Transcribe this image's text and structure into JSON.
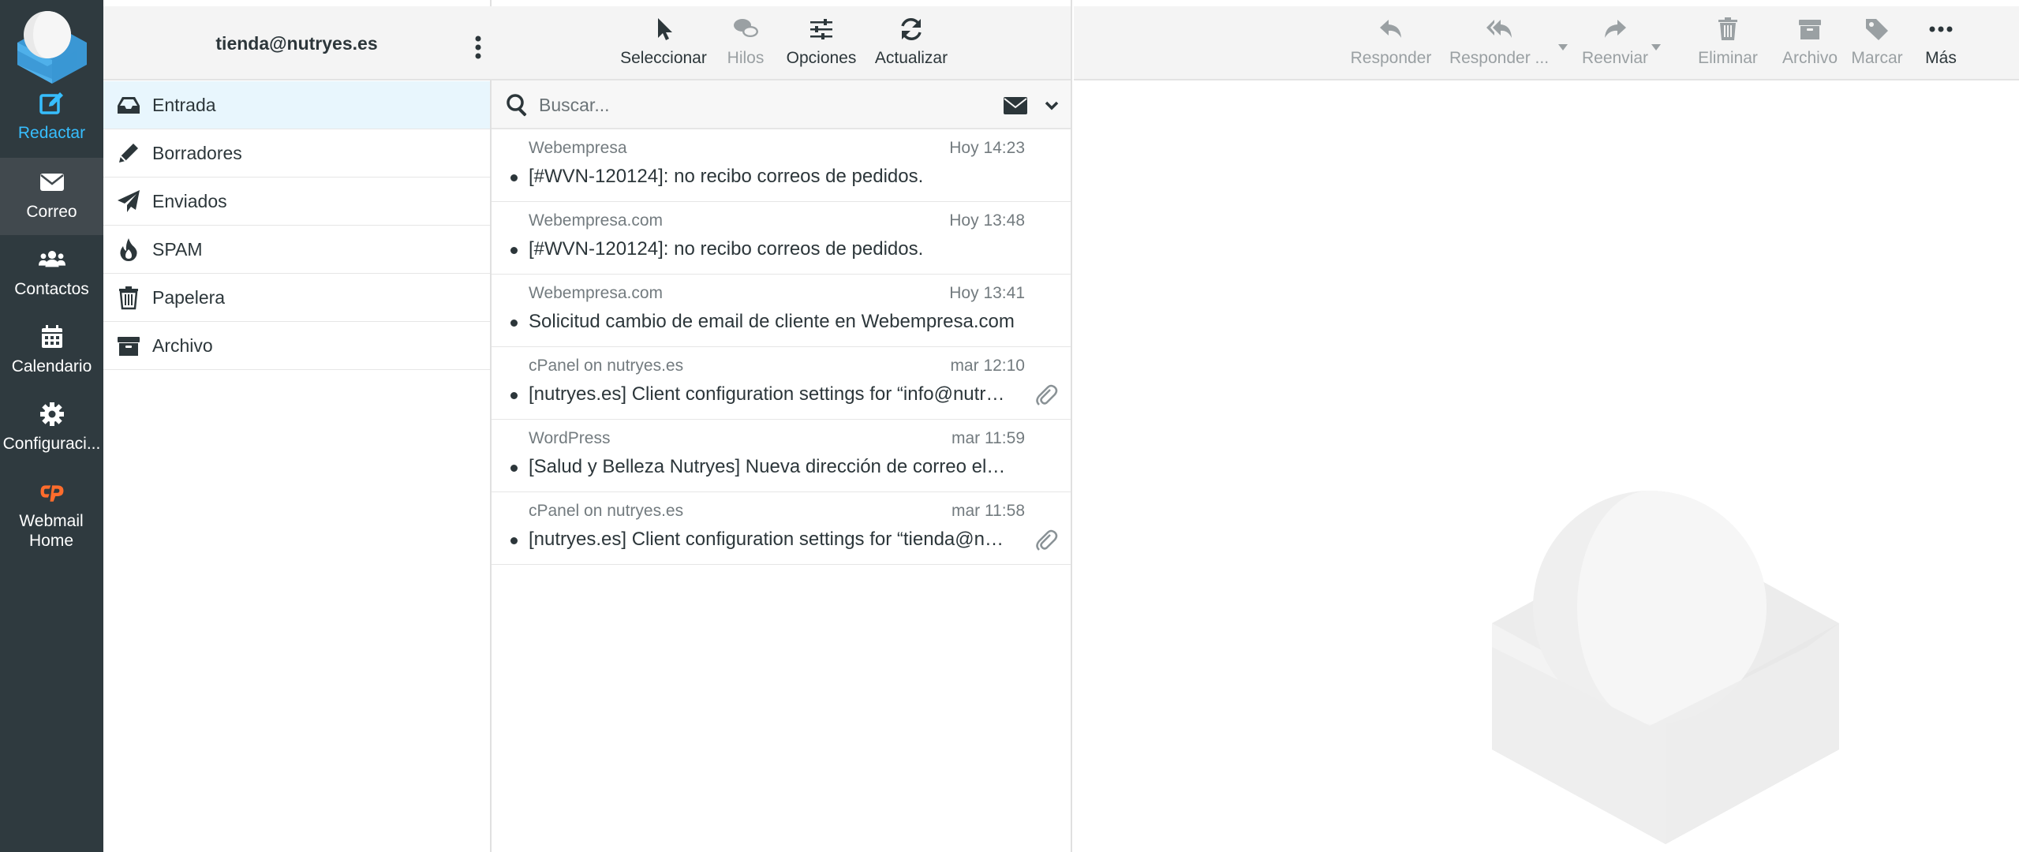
{
  "nav": {
    "items": [
      {
        "id": "compose",
        "label": "Redactar",
        "icon": "compose-icon"
      },
      {
        "id": "mail",
        "label": "Correo",
        "icon": "envelope-icon"
      },
      {
        "id": "contacts",
        "label": "Contactos",
        "icon": "users-icon"
      },
      {
        "id": "calendar",
        "label": "Calendario",
        "icon": "calendar-icon"
      },
      {
        "id": "settings",
        "label": "Configuraci...",
        "icon": "gear-icon"
      },
      {
        "id": "cpanel",
        "label": "Webmail Home",
        "icon": "cpanel-icon"
      }
    ]
  },
  "folders": {
    "account": "tienda@nutryes.es",
    "items": [
      {
        "label": "Entrada",
        "icon": "inbox-icon"
      },
      {
        "label": "Borradores",
        "icon": "pencil-icon"
      },
      {
        "label": "Enviados",
        "icon": "paper-plane-icon"
      },
      {
        "label": "SPAM",
        "icon": "fire-icon"
      },
      {
        "label": "Papelera",
        "icon": "trash-icon"
      },
      {
        "label": "Archivo",
        "icon": "archive-icon"
      }
    ]
  },
  "list_toolbar": {
    "select": "Seleccionar",
    "threads": "Hilos",
    "options": "Opciones",
    "refresh": "Actualizar"
  },
  "search": {
    "placeholder": "Buscar..."
  },
  "messages": [
    {
      "from": "Webempresa",
      "date": "Hoy 14:23",
      "subject": "[#WVN-120124]: no recibo correos de pedidos.",
      "attachment": false
    },
    {
      "from": "Webempresa.com",
      "date": "Hoy 13:48",
      "subject": "[#WVN-120124]: no recibo correos de pedidos.",
      "attachment": false
    },
    {
      "from": "Webempresa.com",
      "date": "Hoy 13:41",
      "subject": "Solicitud cambio de email de cliente en Webempresa.com",
      "attachment": false
    },
    {
      "from": "cPanel on nutryes.es",
      "date": "mar 12:10",
      "subject": "[nutryes.es] Client configuration settings for “info@nutryes.es”.",
      "attachment": true
    },
    {
      "from": "WordPress",
      "date": "mar 11:59",
      "subject": "[Salud y Belleza Nutryes] Nueva dirección de correo electrónico del administrador",
      "attachment": false
    },
    {
      "from": "cPanel on nutryes.es",
      "date": "mar 11:58",
      "subject": "[nutryes.es] Client configuration settings for “tienda@nutryes.es”.",
      "attachment": true
    }
  ],
  "preview_toolbar": {
    "reply": "Responder",
    "reply_all": "Responder ...",
    "forward": "Reenviar",
    "delete": "Eliminar",
    "archive": "Archivo",
    "mark": "Marcar",
    "more": "Más"
  },
  "colors": {
    "nav_bg": "#2f3a3f",
    "accent": "#37beff",
    "active_folder": "#e8f6fd",
    "cpanel_orange": "#ff6c2c"
  }
}
